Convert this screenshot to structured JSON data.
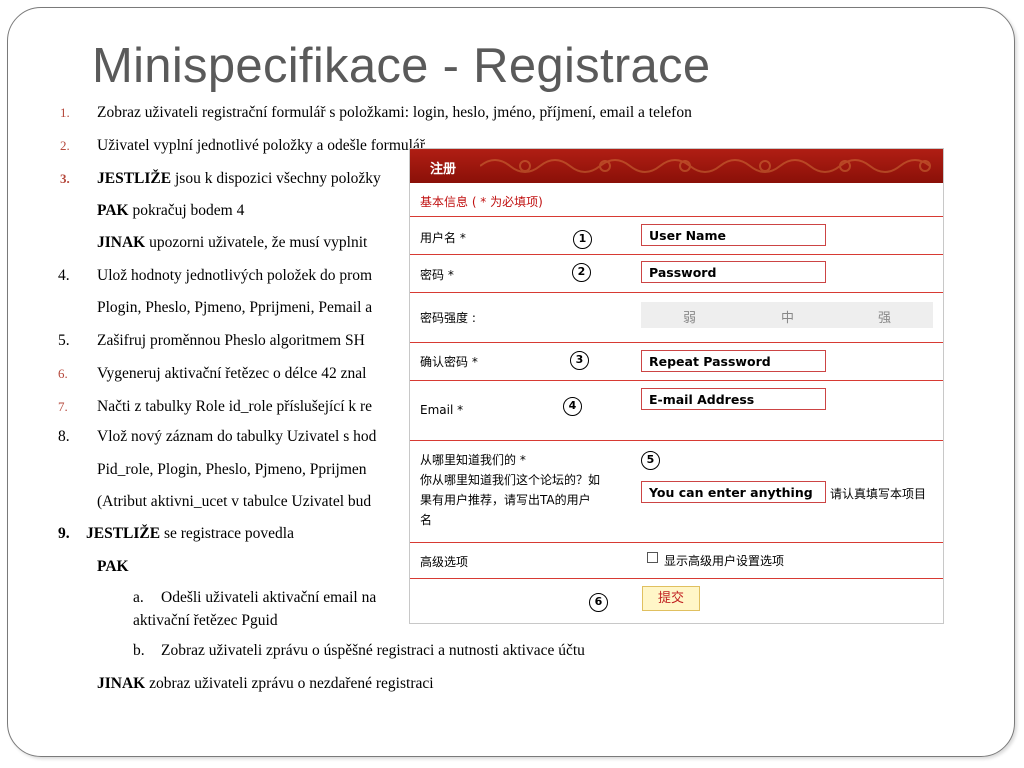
{
  "title": "Minispecifikace - Registrace",
  "list": [
    {
      "marker": "1.",
      "text": "Zobraz uživateli registrační formulář s položkami: login, heslo, jméno, příjmení, email a telefon"
    },
    {
      "marker": "2.",
      "text": "Uživatel vyplní jednotlivé položky a odešle formulář"
    },
    {
      "marker": "3.",
      "bold": "JESTLIŽE",
      "text": " jsou k dispozici všechny položky"
    },
    {
      "bold": "PAK",
      "text": " pokračuj bodem 4"
    },
    {
      "bold": "JINAK",
      "text": " upozorni uživatele, že musí vyplnit"
    },
    {
      "marker": "4.",
      "text": "Ulož hodnoty jednotlivých položek do prom"
    },
    {
      "text": "Plogin, Pheslo, Pjmeno, Pprijmeni, Pemail a"
    },
    {
      "marker": "5.",
      "text": "Zašifruj proměnnou Pheslo algoritmem SH"
    },
    {
      "marker": "6.",
      "text": "Vygeneruj aktivační řetězec o délce 42 znal"
    },
    {
      "marker": "7.",
      "text": "Načti z tabulky Role id_role příslušející k re"
    },
    {
      "marker": "8.",
      "text": "Vlož nový záznam do tabulky Uzivatel s hod"
    },
    {
      "text": "Pid_role, Plogin, Pheslo, Pjmeno, Pprijmen"
    },
    {
      "text": "(Atribut aktivni_ucet v tabulce Uzivatel bud"
    },
    {
      "marker": "9.",
      "bold": "JESTLIŽE",
      "text": " se registrace povedla"
    },
    {
      "bold": "PAK",
      "text": ""
    },
    {
      "marker": "a.",
      "text": "Odešli uživateli aktivační email na"
    },
    {
      "text": "aktivační řetězec Pguid"
    },
    {
      "marker": "b.",
      "text": "Zobraz uživateli zprávu o úspěšné registraci a nutnosti aktivace účtu"
    },
    {
      "bold": "JINAK",
      "text": " zobraz uživateli zprávu o nezdařené registraci"
    }
  ],
  "form": {
    "header": "注册",
    "section": "基本信息 ( * 为必填项)",
    "username_label": "用户名 *",
    "username_value": "User Name",
    "password_label": "密码 *",
    "password_value": "Password",
    "strength_label": "密码强度 :",
    "strength_weak": "弱",
    "strength_medium": "中",
    "strength_strong": "强",
    "confirm_label": "确认密码 *",
    "confirm_value": "Repeat Password",
    "email_label": "Email *",
    "email_value": "E-mail Address",
    "source_label_1": "从哪里知道我们的 *",
    "source_label_2": "你从哪里知道我们这个论坛的？如",
    "source_label_3": "果有用户推荐，请写出TA的用户",
    "source_label_4": "名",
    "source_value": "You can enter anything",
    "source_hint": "请认真填写本项目",
    "advanced_label": "高级选项",
    "advanced_checkbox": "显示高级用户设置选项",
    "submit": "提交",
    "markers": [
      "1",
      "2",
      "3",
      "4",
      "5",
      "6"
    ]
  }
}
